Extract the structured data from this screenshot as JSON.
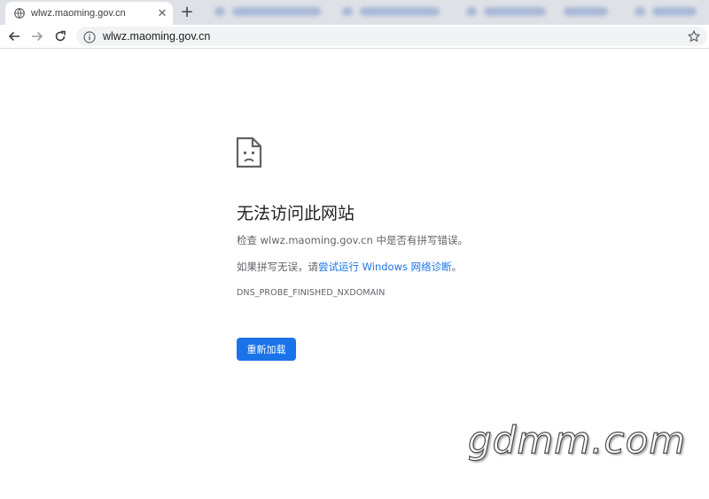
{
  "browser": {
    "tab": {
      "title": "wlwz.maoming.gov.cn",
      "close_label": "✕",
      "favicon": "globe-icon"
    },
    "new_tab_label": "+",
    "address_bar": {
      "url": "wlwz.maoming.gov.cn",
      "security_icon": "info-icon"
    },
    "nav_icons": [
      "back-arrow-icon",
      "forward-arrow-icon",
      "reload-icon"
    ],
    "bookmark_icon": "star-icon"
  },
  "error_page": {
    "icon": "broken-page-icon",
    "title": "无法访问此网站",
    "check_line": "检查 wlwz.maoming.gov.cn 中是否有拼写错误。",
    "suggest_prefix": "如果拼写无误，请",
    "suggest_link": "尝试运行 Windows 网络诊断",
    "suggest_suffix": "。",
    "error_code": "DNS_PROBE_FINISHED_NXDOMAIN",
    "reload_button": "重新加载",
    "accent_color": "#1a73e8"
  },
  "watermark": "gdmm.com"
}
